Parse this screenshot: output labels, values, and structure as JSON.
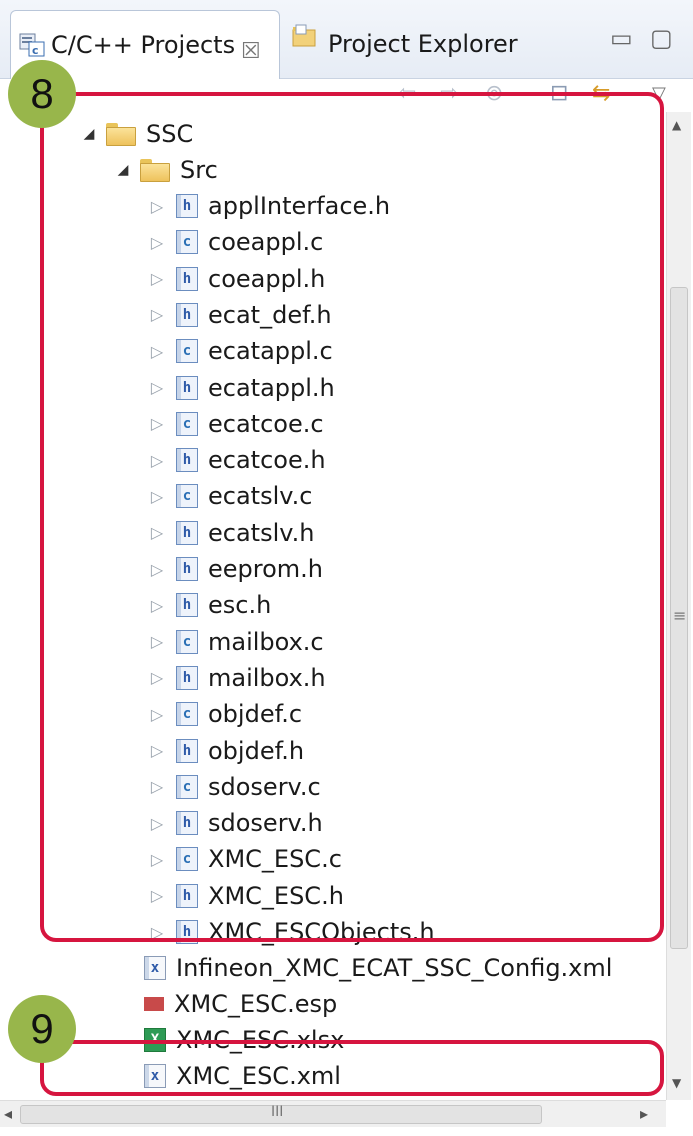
{
  "tabs": [
    {
      "label": "C/C++ Projects",
      "icon": "cpp-projects-icon",
      "active": true,
      "close": "☒"
    },
    {
      "label": "Project Explorer",
      "icon": "project-explorer-icon",
      "active": false
    }
  ],
  "window_controls": {
    "minimize": "▭",
    "maximize": "▢"
  },
  "toolbar": {
    "back": "⇦",
    "forward": "⇨",
    "link": "⊚",
    "collapse": "⊟",
    "sync": "⇆",
    "menu": "▽"
  },
  "tree": {
    "project": "SSC",
    "folder": "Src",
    "files": [
      {
        "name": "applInterface.h",
        "type": "h"
      },
      {
        "name": "coeappl.c",
        "type": "c"
      },
      {
        "name": "coeappl.h",
        "type": "h"
      },
      {
        "name": "ecat_def.h",
        "type": "h"
      },
      {
        "name": "ecatappl.c",
        "type": "c"
      },
      {
        "name": "ecatappl.h",
        "type": "h"
      },
      {
        "name": "ecatcoe.c",
        "type": "c"
      },
      {
        "name": "ecatcoe.h",
        "type": "h"
      },
      {
        "name": "ecatslv.c",
        "type": "c"
      },
      {
        "name": "ecatslv.h",
        "type": "h"
      },
      {
        "name": "eeprom.h",
        "type": "h"
      },
      {
        "name": "esc.h",
        "type": "h"
      },
      {
        "name": "mailbox.c",
        "type": "c"
      },
      {
        "name": "mailbox.h",
        "type": "h"
      },
      {
        "name": "objdef.c",
        "type": "c"
      },
      {
        "name": "objdef.h",
        "type": "h"
      },
      {
        "name": "sdoserv.c",
        "type": "c"
      },
      {
        "name": "sdoserv.h",
        "type": "h"
      },
      {
        "name": "XMC_ESC.c",
        "type": "c"
      },
      {
        "name": "XMC_ESC.h",
        "type": "h"
      },
      {
        "name": "XMC_ESCObjects.h",
        "type": "h"
      }
    ],
    "root_files": [
      {
        "name": "Infineon_XMC_ECAT_SSC_Config.xml",
        "type": "x"
      },
      {
        "name": "XMC_ESC.esp",
        "type": "esp"
      },
      {
        "name": "XMC_ESC.xlsx",
        "type": "xlsx"
      },
      {
        "name": "XMC_ESC.xml",
        "type": "x"
      }
    ]
  },
  "callouts": [
    {
      "number": "8",
      "color": "#98b64b",
      "border": "#d6153f"
    },
    {
      "number": "9",
      "color": "#98b64b",
      "border": "#d6153f"
    }
  ],
  "scrollbar": {
    "grip": "≡",
    "hgrip": "III",
    "up": "▲",
    "down": "▼",
    "left": "◂",
    "right": "▸"
  }
}
